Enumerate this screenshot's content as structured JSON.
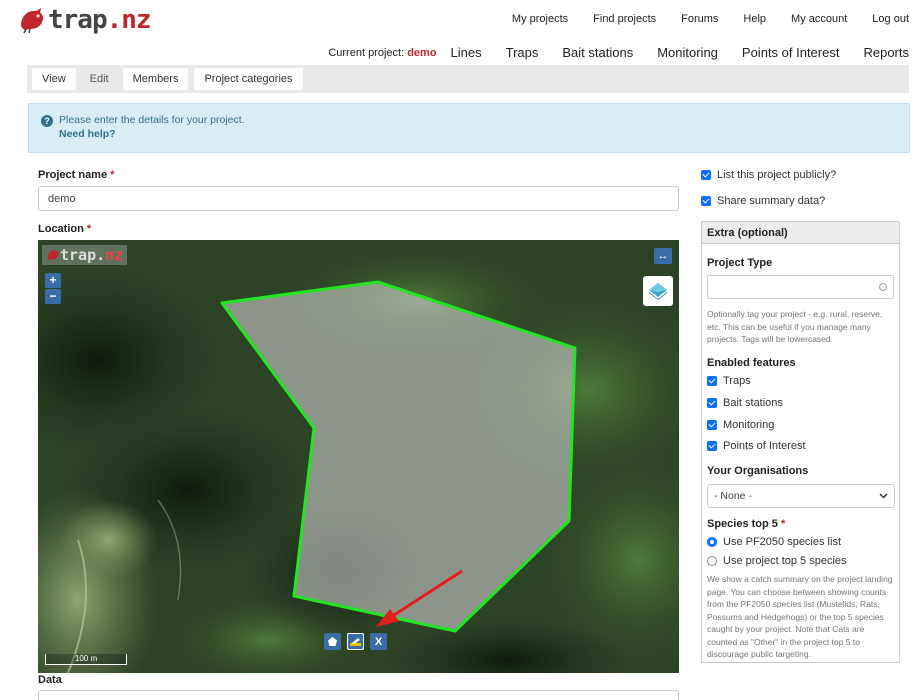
{
  "logo": {
    "text_main": "trap",
    "text_dot": ".",
    "text_suffix": "nz"
  },
  "topnav": [
    "My projects",
    "Find projects",
    "Forums",
    "Help",
    "My account",
    "Log out"
  ],
  "subnav": {
    "current_label": "Current project:",
    "current_value": "demo",
    "items": [
      "Lines",
      "Traps",
      "Bait stations",
      "Monitoring",
      "Points of Interest",
      "Reports"
    ]
  },
  "tabs": [
    "View",
    "Edit",
    "Members",
    "Project categories"
  ],
  "info": {
    "message": "Please enter the details for your project.",
    "help": "Need help?"
  },
  "form": {
    "project_name_label": "Project name",
    "project_name_value": "demo",
    "location_label": "Location",
    "data_label": "Data",
    "required_mark": "*"
  },
  "map": {
    "logo_main": "trap.",
    "logo_suffix": "nz",
    "zoom_in": "+",
    "zoom_out": "−",
    "expand": "↔",
    "scale": "100 m",
    "delete_label": "X"
  },
  "right": {
    "list_public": "List this project publicly?",
    "share_summary": "Share summary data?",
    "extra_title": "Extra (optional)",
    "project_type_label": "Project Type",
    "project_type_help": "Optionally tag your project - e.g. rural, reserve, etc. This can be useful if you manage many projects. Tags will be lowercased.",
    "enabled_features_label": "Enabled features",
    "features": [
      "Traps",
      "Bait stations",
      "Monitoring",
      "Points of Interest"
    ],
    "organisations_label": "Your Organisations",
    "organisations_value": "- None -",
    "species_label": "Species top 5",
    "species_options": [
      "Use PF2050 species list",
      "Use project top 5 species"
    ],
    "species_help": "We show a catch summary on the project landing page. You can choose between showing counts from the PF2050 species list (Mustelids, Rats, Possums and Hedgehogs) or the top 5 species caught by your project. Note that Cats are counted as \"Other\" in the project top 5 to discourage public targeting."
  },
  "colors": {
    "brand_red": "#c0262c",
    "accent_blue": "#0d6efd",
    "map_button_blue": "#3a6da5",
    "polygon_stroke": "#22e622",
    "info_bg": "#d9edf7"
  }
}
